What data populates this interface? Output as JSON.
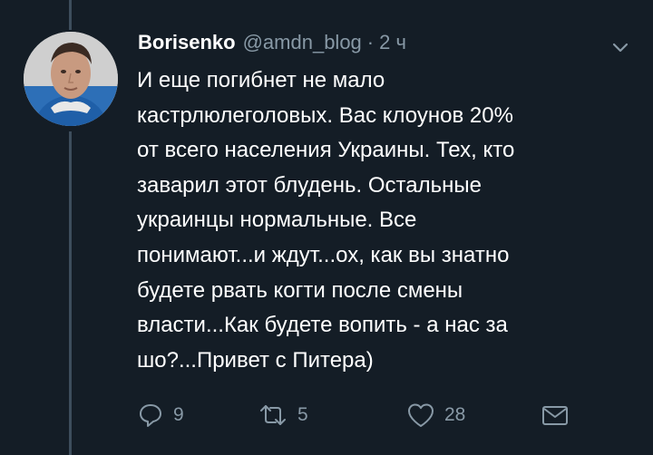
{
  "tweet": {
    "author_name": "Borisenko",
    "author_handle": "@amdn_blog",
    "separator": "·",
    "timestamp": "2 ч",
    "text_lines": [
      "И еще погибнет не мало",
      "кастрлюлеголовых. Вас клоунов 20%",
      "от всего населения Украины. Тех, кто",
      "заварил этот блудень. Остальные",
      "украинцы нормальные. Все",
      "понимают...и ждут...ох, как вы знатно",
      "будете рвать когти после смены",
      "власти...Как будете вопить - а нас за",
      "шо?...Привет с Питера)"
    ],
    "actions": {
      "reply_count": "9",
      "retweet_count": "5",
      "like_count": "28"
    }
  },
  "icons": {
    "reply": "reply-icon",
    "retweet": "retweet-icon",
    "like": "heart-icon",
    "dm": "envelope-icon",
    "menu": "chevron-down-icon"
  },
  "colors": {
    "background": "#141d26",
    "text": "#ffffff",
    "secondary": "#8899a6",
    "thread_line": "#3d4d5c"
  }
}
